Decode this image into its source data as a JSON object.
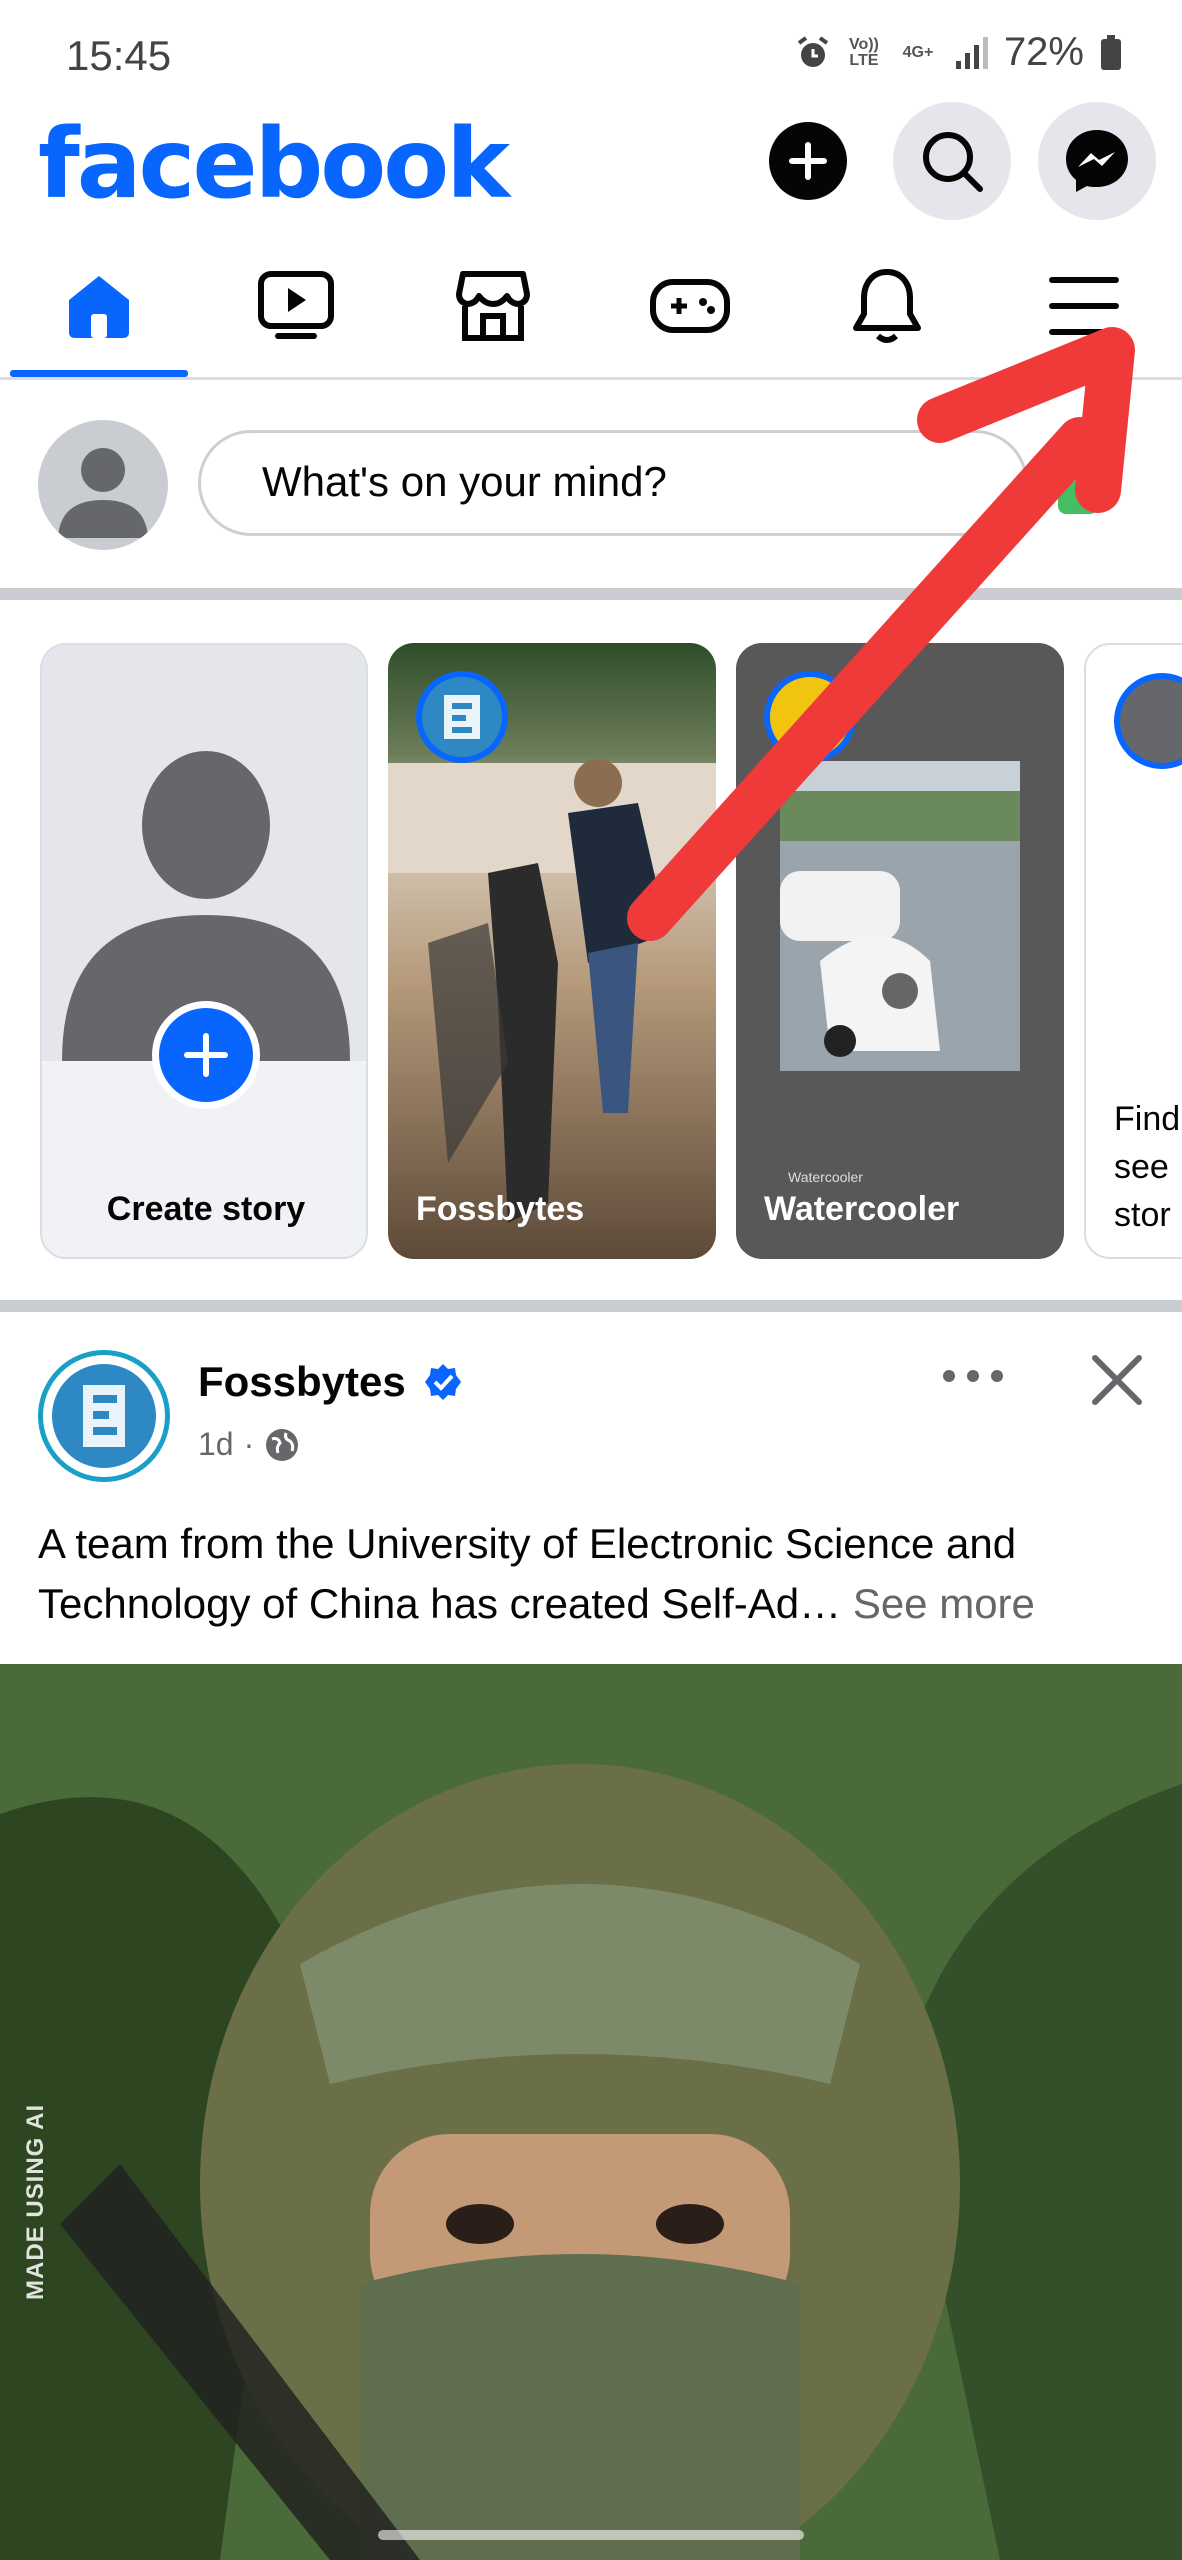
{
  "status_bar": {
    "time": "15:45",
    "volte": "Vo)) LTE",
    "network": "4G+",
    "battery": "72%",
    "icons": [
      "alarm-icon",
      "volte-icon",
      "network-icon",
      "signal-icon",
      "battery-icon"
    ]
  },
  "header": {
    "logo": "facebook",
    "buttons": [
      "create-icon",
      "search-icon",
      "messenger-icon"
    ],
    "brand_color": "#0866ff"
  },
  "nav": {
    "tabs": [
      {
        "name": "home",
        "icon": "home-icon",
        "active": true
      },
      {
        "name": "video",
        "icon": "video-icon",
        "active": false
      },
      {
        "name": "marketplace",
        "icon": "marketplace-icon",
        "active": false
      },
      {
        "name": "gaming",
        "icon": "gaming-icon",
        "active": false
      },
      {
        "name": "notifications",
        "icon": "bell-icon",
        "active": false
      },
      {
        "name": "menu",
        "icon": "hamburger-icon",
        "active": false
      }
    ]
  },
  "composer": {
    "placeholder": "What's on your mind?",
    "photo_icon": "photo-icon"
  },
  "stories": [
    {
      "label": "Create story",
      "type": "create"
    },
    {
      "label": "Fossbytes",
      "type": "story"
    },
    {
      "label": "Watercooler",
      "type": "story",
      "watermark": "Watercooler"
    },
    {
      "label": "Find see stor",
      "lines": [
        "Find",
        "see",
        "stor"
      ],
      "type": "suggestion"
    }
  ],
  "post": {
    "author": "Fossbytes",
    "verified": true,
    "time": "1d",
    "separator": "·",
    "audience_icon": "globe-icon",
    "text": "A team from the University of Electronic Science and Technology of China has created Self-Ad…",
    "see_more": "See more",
    "image_label": "MADE USING AI"
  },
  "annotation": {
    "type": "red-arrow",
    "points_to": "hamburger-icon",
    "color": "#f03a3a"
  }
}
